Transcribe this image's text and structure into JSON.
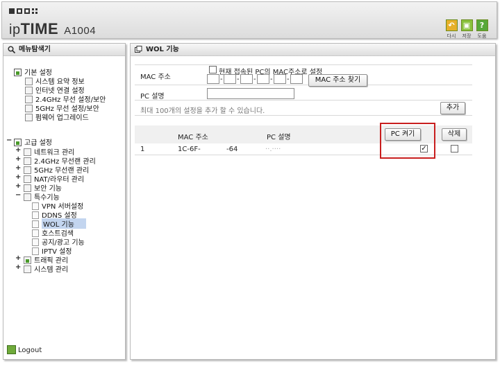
{
  "header": {
    "brand_prefix": "ip",
    "brand_main": "TIME",
    "model": "A1004",
    "buttons": [
      {
        "label": "다시",
        "icon": "undo-icon",
        "color": "#e6b02a"
      },
      {
        "label": "저장",
        "icon": "save-icon",
        "color": "#88c13c"
      },
      {
        "label": "도움",
        "icon": "help-icon",
        "color": "#56a83a"
      }
    ]
  },
  "sidebar": {
    "title": "메뉴탐색기",
    "basic": {
      "label": "기본 설정",
      "items": [
        "시스템 요약 정보",
        "인터넷 연결 설정",
        "2.4GHz 무선 설정/보안",
        "5GHz 무선 설정/보안",
        "펌웨어 업그레이드"
      ]
    },
    "advanced": {
      "label": "고급 설정",
      "items": [
        "네트워크 관리",
        "2.4GHz 무선랜 관리",
        "5GHz 무선랜 관리",
        "NAT/라우터 관리",
        "보안 기능",
        "특수기능"
      ],
      "special_items": [
        "VPN 서버설정",
        "DDNS 설정",
        "WOL 기능",
        "호스트검색",
        "공지/광고 기능",
        "IPTV 설정"
      ],
      "tail_items": [
        "트래픽 관리",
        "시스템 관리"
      ]
    },
    "logout": "Logout"
  },
  "main": {
    "title": "WOL 기능",
    "mac_label": "MAC 주소",
    "use_current_label": "현재 접속된 PC의 MAC주소로 설정",
    "find_mac_button": "MAC 주소 찾기",
    "pc_desc_label": "PC 설명",
    "pc_desc_value": "",
    "limit_note": "최대 100개의 설정을 추가 할 수 있습니다.",
    "add_button": "추가",
    "table": {
      "headers": [
        "MAC 주소",
        "PC 설명"
      ],
      "wake_button": "PC 켜기",
      "delete_button": "삭제",
      "rows": [
        {
          "index": "1",
          "mac_start": "1C-6F-",
          "mac_end": "-64",
          "desc": "··.····",
          "wake": true,
          "delete": false
        }
      ]
    }
  }
}
